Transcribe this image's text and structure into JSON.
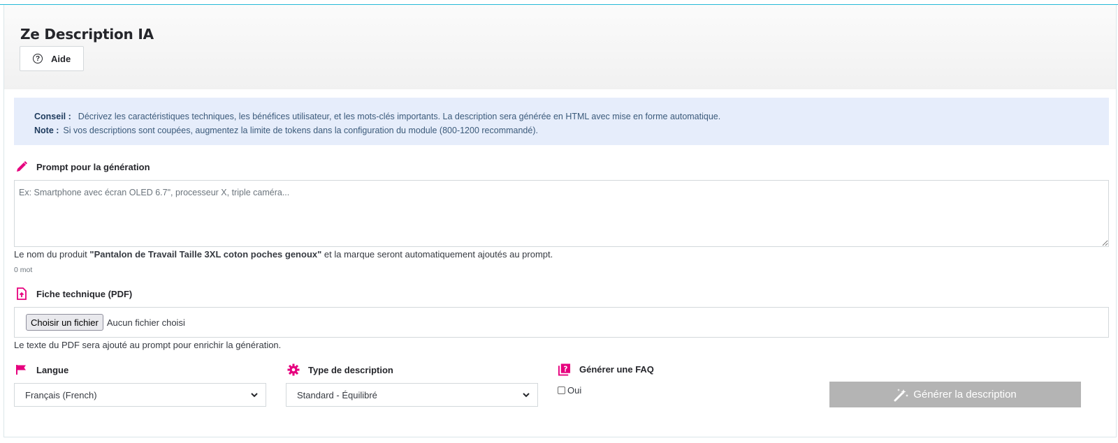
{
  "header": {
    "title": "Ze Description IA",
    "help_label": "Aide"
  },
  "tip": {
    "conseil_label": "Conseil :",
    "conseil_text": "Décrivez les caractéristiques techniques, les bénéfices utilisateur, et les mots-clés importants. La description sera générée en HTML avec mise en forme automatique.",
    "note_label": "Note :",
    "note_text": "Si vos descriptions sont coupées, augmentez la limite de tokens dans la configuration du module (800-1200 recommandé)."
  },
  "prompt": {
    "label": "Prompt pour la génération",
    "placeholder": "Ex: Smartphone avec écran OLED 6.7\", processeur X, triple caméra...",
    "value": "",
    "help_prefix": "Le nom du produit ",
    "product_name": "\"Pantalon de Travail Taille 3XL coton poches genoux\"",
    "help_suffix": " et la marque seront automatiquement ajoutés au prompt.",
    "word_count": "0 mot"
  },
  "pdf": {
    "label": "Fiche technique (PDF)",
    "button_label": "Choisir un fichier",
    "file_name": "Aucun fichier choisi",
    "help": "Le texte du PDF sera ajouté au prompt pour enrichir la génération."
  },
  "language": {
    "label": "Langue",
    "selected": "Français (French)"
  },
  "description_type": {
    "label": "Type de description",
    "selected": "Standard - Équilibré"
  },
  "faq": {
    "label": "Générer une FAQ",
    "checkbox_label": "Oui",
    "checked": false
  },
  "generate_button": {
    "label": "Générer la description"
  },
  "colors": {
    "accent": "#e6007e",
    "tip_background": "#e6edfb",
    "button_disabled": "#b4b4b4"
  }
}
